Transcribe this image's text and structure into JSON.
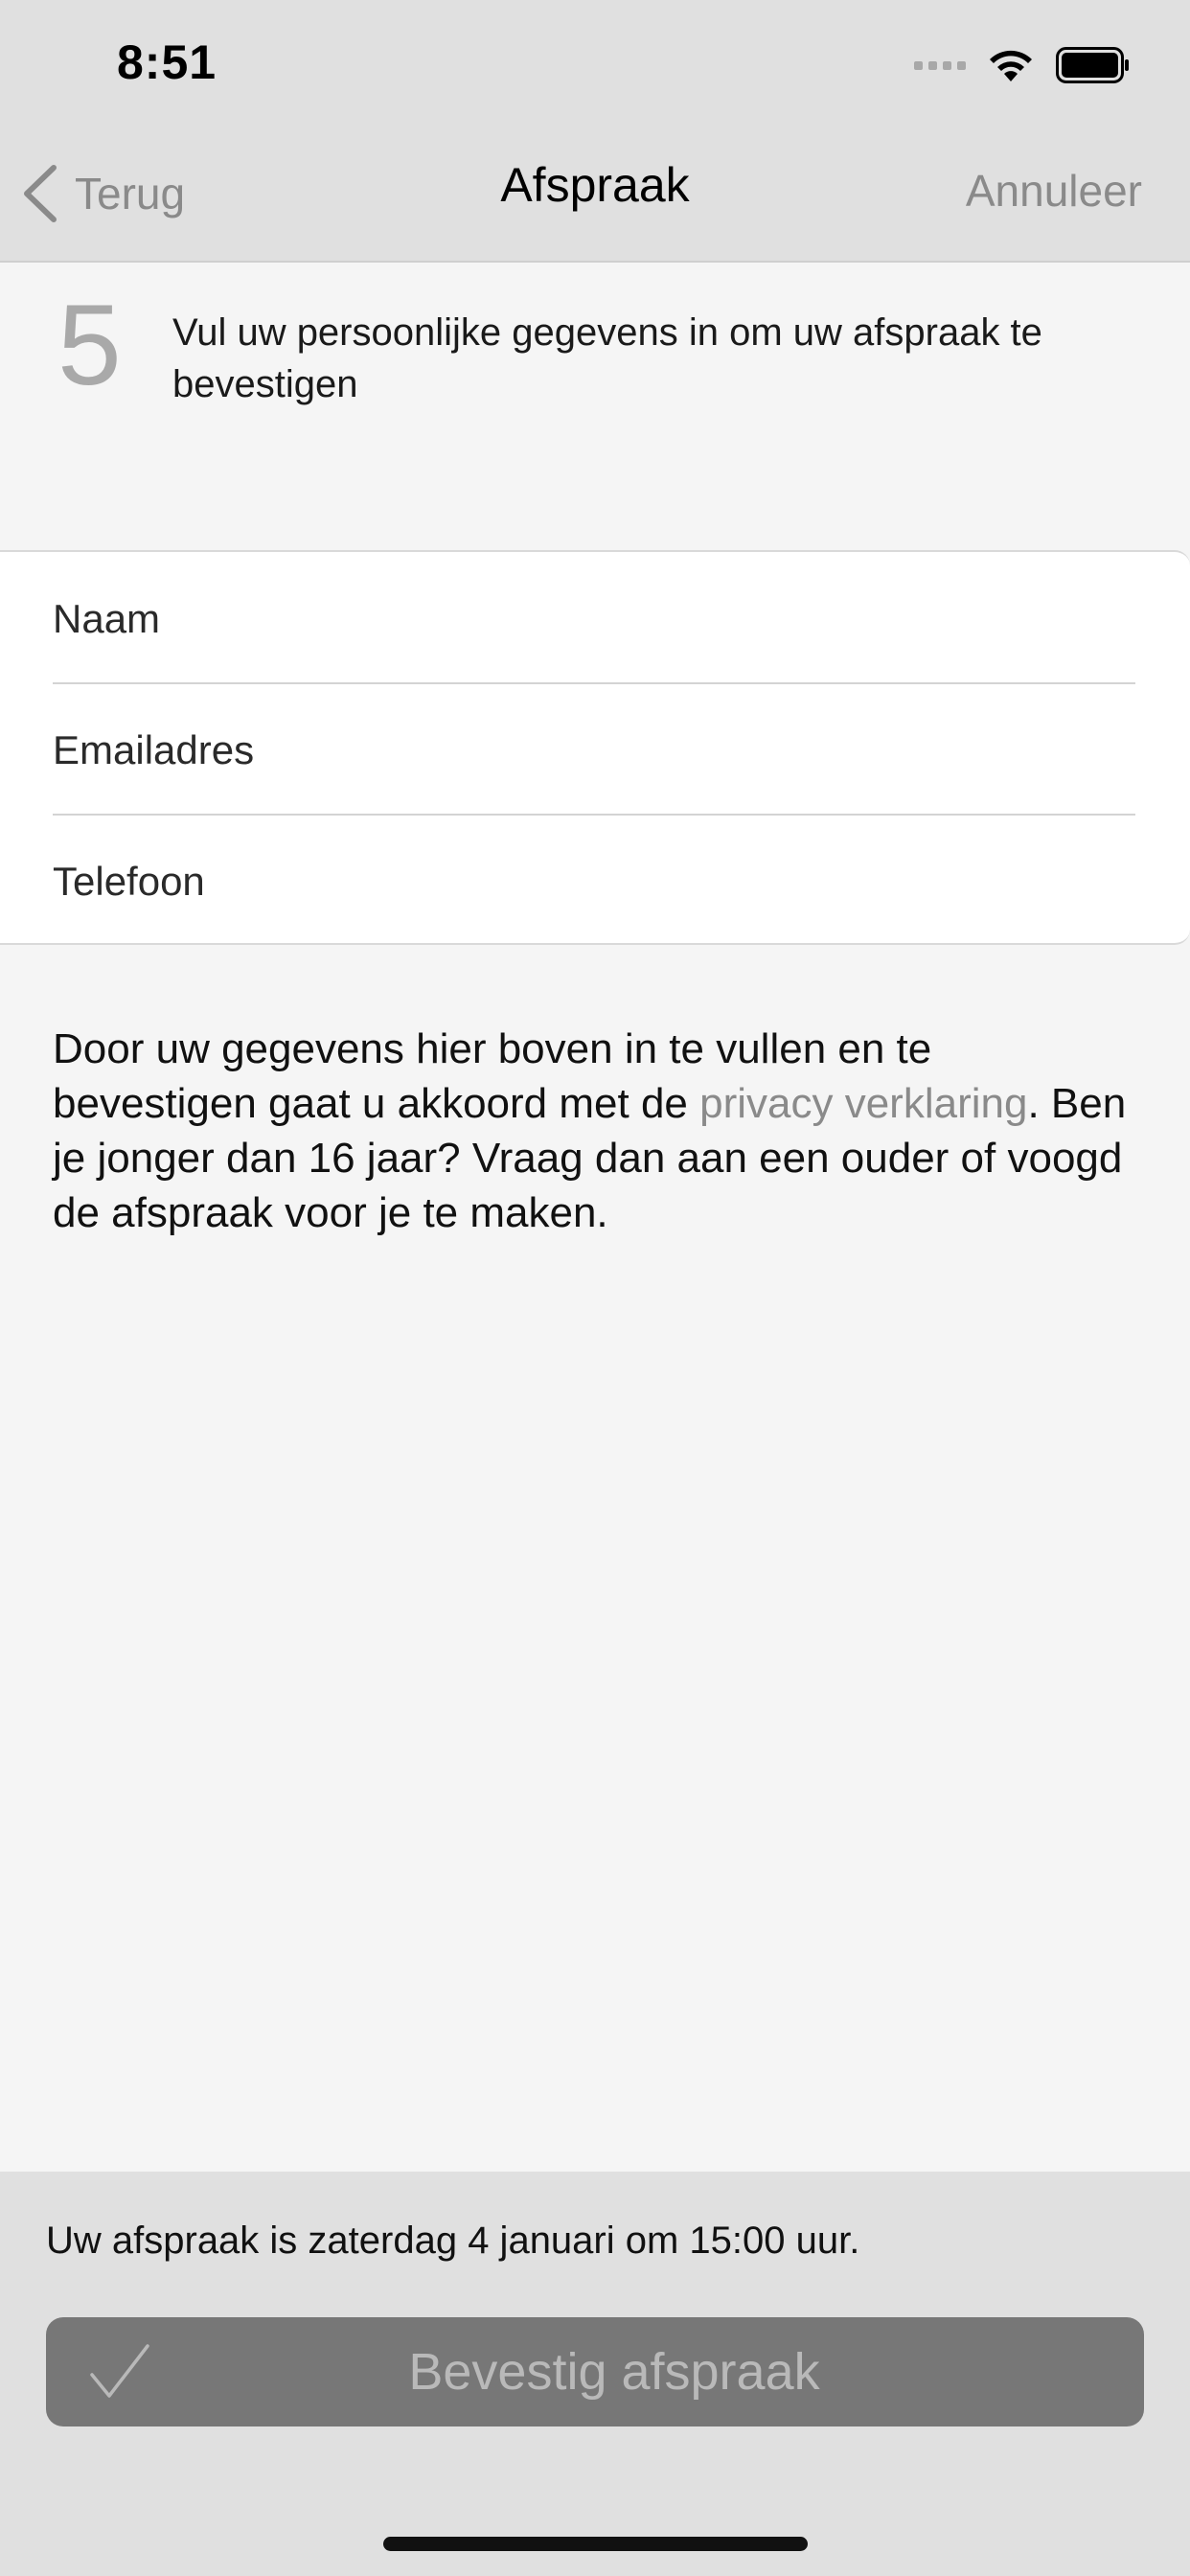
{
  "status_bar": {
    "time": "8:51",
    "icons": [
      "signal-icon",
      "wifi-icon",
      "battery-icon"
    ]
  },
  "nav": {
    "back_label": "Terug",
    "title": "Afspraak",
    "cancel_label": "Annuleer"
  },
  "step": {
    "number": "5",
    "instruction": "Vul uw persoonlijke gegevens in om uw afspraak te bevestigen"
  },
  "form": {
    "name_placeholder": "Naam",
    "email_placeholder": "Emailadres",
    "phone_placeholder": "Telefoon"
  },
  "disclaimer": {
    "part1": "Door uw gegevens hier boven in te vullen en te bevestigen gaat u akkoord met de ",
    "link": "privacy verklaring",
    "part2": ". Ben je jonger dan 16 jaar? Vraag dan aan een ouder of voogd de afspraak voor je te maken."
  },
  "footer": {
    "summary": "Uw afspraak is zaterdag 4 januari om 15:00 uur.",
    "confirm_label": "Bevestig afspraak"
  },
  "colors": {
    "bar_background": "#e0e0e0",
    "page_background": "#f5f5f5",
    "button_background": "#777777",
    "muted_text": "#8a8a8a"
  }
}
